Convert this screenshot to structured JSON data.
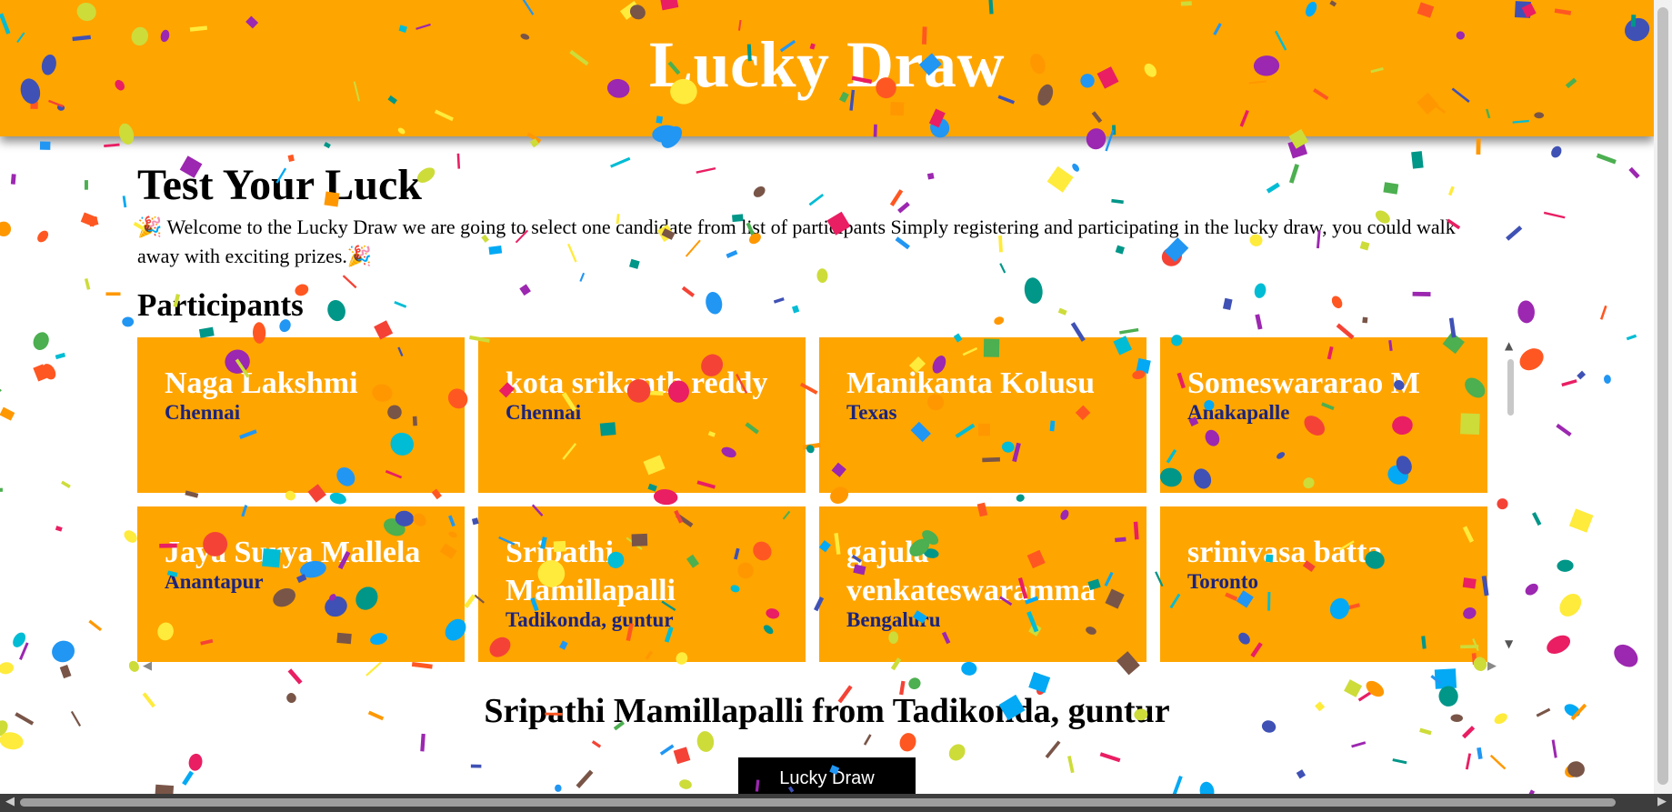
{
  "header": {
    "title": "Lucky Draw"
  },
  "main": {
    "heading": "Test Your Luck",
    "intro": "🎉 Welcome to the Lucky Draw we are going to select one candidate from list of participants Simply registering and participating in the lucky draw, you could walk away with exciting prizes.🎉",
    "participants_heading": "Participants"
  },
  "participants": [
    {
      "name": "Naga Lakshmi",
      "city": "Chennai"
    },
    {
      "name": "kota srikanth reddy",
      "city": "Chennai"
    },
    {
      "name": "Manikanta Kolusu",
      "city": "Texas"
    },
    {
      "name": "Someswararao M",
      "city": "Anakapalle"
    },
    {
      "name": "Jaya Surya Mallela",
      "city": "Anantapur"
    },
    {
      "name": "Sripathi Mamillapalli",
      "city": "Tadikonda, guntur"
    },
    {
      "name": "gajula venkateswaramma",
      "city": "Bengaluru"
    },
    {
      "name": "srinivasa batta",
      "city": "Toronto"
    }
  ],
  "result": {
    "winner_text": "Sripathi Mamillapalli from Tadikonda, guntur"
  },
  "draw_button": {
    "label": "Lucky Draw"
  },
  "colors": {
    "accent": "#FFA500",
    "city_text": "#1a237e",
    "button_bg": "#000000"
  },
  "icons": {
    "scroll_up": "▲",
    "scroll_down": "▼",
    "scroll_left": "◀",
    "scroll_right": "▶"
  }
}
